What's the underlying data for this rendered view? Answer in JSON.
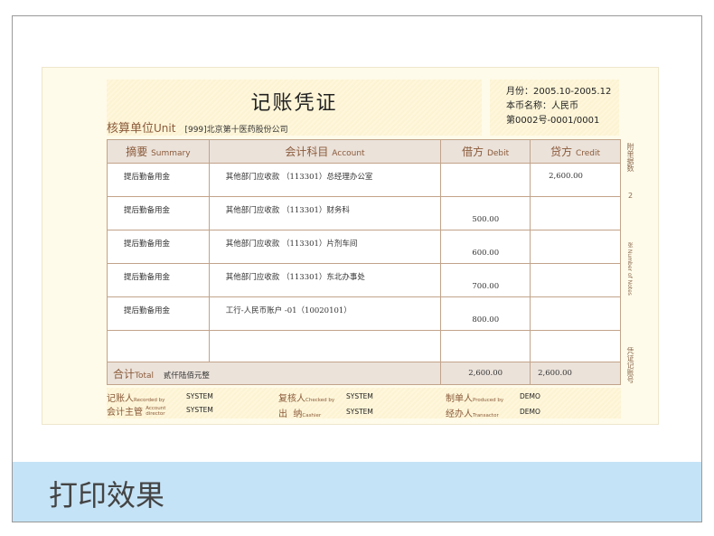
{
  "voucher": {
    "title": "记账凭证",
    "unit_label": "核算单位",
    "unit_label_en": "Unit",
    "unit_value": "[999]北京第十医药股份公司",
    "info": [
      "月份：2005.10-2005.12",
      "本币名称：人民币",
      "第0002号-0001/0001"
    ],
    "headers": [
      {
        "cn": "摘要",
        "en": "Summary"
      },
      {
        "cn": "会计科目",
        "en": "Account"
      },
      {
        "cn": "借方",
        "en": "Debit"
      },
      {
        "cn": "贷方",
        "en": "Credit"
      }
    ],
    "rows": [
      {
        "summary": "提后勤备用金",
        "account": "其他部门应收款  （113301）总经理办公室",
        "debit": "",
        "credit": "2,600.00"
      },
      {
        "summary": "提后勤备用金",
        "account": "其他部门应收款  （113301）财务科",
        "debit": "500.00",
        "credit": ""
      },
      {
        "summary": "提后勤备用金",
        "account": "其他部门应收款 （113301）片剂车间",
        "debit": "600.00",
        "credit": ""
      },
      {
        "summary": "提后勤备用金",
        "account": "其他部门应收款 （113301）东北办事处",
        "debit": "700.00",
        "credit": ""
      },
      {
        "summary": "提后勤备用金",
        "account": "工行-人民币账户 -01（10020101）",
        "debit": "800.00",
        "credit": ""
      },
      {
        "summary": "",
        "account": "",
        "debit": "",
        "credit": ""
      }
    ],
    "total": {
      "cn": "合计",
      "en": "Total",
      "words": "贰仟陆佰元整",
      "debit": "2,600.00",
      "credit": "2,600.00"
    },
    "side": {
      "attach_label": "附单据数",
      "attach_count": "2",
      "unit": "张 Number of Notes",
      "bottom": "凭证记账号"
    },
    "signatures": [
      {
        "cn": "记账人",
        "en": "Recorded by",
        "value": "SYSTEM"
      },
      {
        "cn": "复核人",
        "en": "Checked by",
        "value": "SYSTEM"
      },
      {
        "cn": "制单人",
        "en": "Produced by",
        "value": "DEMO"
      },
      {
        "cn": "会计主管",
        "en": "Account director",
        "value": "SYSTEM"
      },
      {
        "cn": "出  纳",
        "en": "Cashier",
        "value": "SYSTEM"
      },
      {
        "cn": "经办人",
        "en": "Transactor",
        "value": "DEMO"
      }
    ]
  },
  "caption": "打印效果"
}
